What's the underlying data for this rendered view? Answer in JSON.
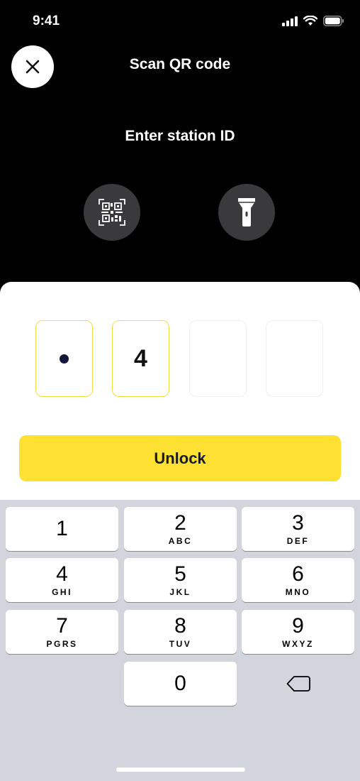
{
  "status_bar": {
    "time": "9:41"
  },
  "header": {
    "title": "Scan QR code"
  },
  "station": {
    "title": "Enter station ID",
    "code": {
      "digits": [
        "",
        "4",
        "",
        ""
      ],
      "masked_index": 0
    }
  },
  "actions": {
    "unlock_label": "Unlock"
  },
  "icons": {
    "close": "close-icon",
    "qr": "qr-code-icon",
    "flashlight": "flashlight-icon",
    "backspace": "backspace-icon"
  },
  "colors": {
    "accent": "#fce032",
    "accent_border": "#f7dc4a",
    "background": "#000000",
    "keypad_bg": "#d2d5db",
    "round_button_bg": "#3a3a3c"
  },
  "keypad": {
    "keys": [
      {
        "num": "1",
        "letters": ""
      },
      {
        "num": "2",
        "letters": "ABC"
      },
      {
        "num": "3",
        "letters": "DEF"
      },
      {
        "num": "4",
        "letters": "GHI"
      },
      {
        "num": "5",
        "letters": "JKL"
      },
      {
        "num": "6",
        "letters": "MNO"
      },
      {
        "num": "7",
        "letters": "PGRS"
      },
      {
        "num": "8",
        "letters": "TUV"
      },
      {
        "num": "9",
        "letters": "WXYZ"
      },
      {
        "num": "0",
        "letters": ""
      }
    ]
  }
}
